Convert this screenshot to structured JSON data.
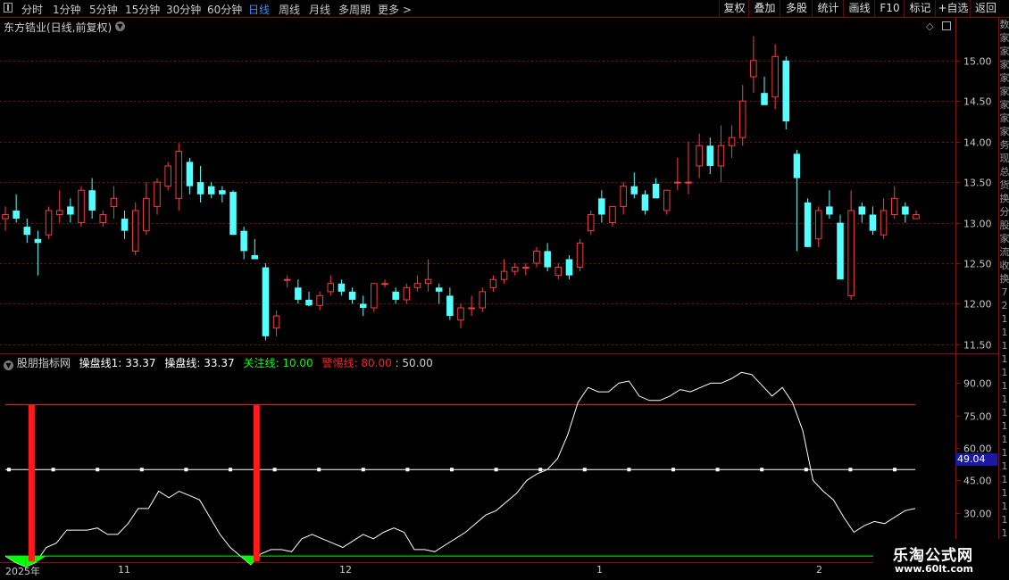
{
  "topbar": {
    "periods": [
      "分时",
      "1分钟",
      "5分钟",
      "15分钟",
      "30分钟",
      "60分钟",
      "日线",
      "周线",
      "月线",
      "多周期",
      "更多 >"
    ],
    "active_period": "日线",
    "right_buttons": [
      "复权",
      "叠加",
      "多股",
      "统计",
      "画线",
      "F10",
      "标记",
      "+自选",
      "返回"
    ]
  },
  "main_chart": {
    "title": "东方锆业(日线,前复权)",
    "title_icon": "chevron-down-icon",
    "price_ticks": [
      "15.00",
      "14.50",
      "14.00",
      "13.50",
      "13.00",
      "12.50",
      "12.00",
      "11.50"
    ],
    "up_color": "#ff3b3b",
    "down_color": "#54ffff"
  },
  "indicator": {
    "name": "股朋指标网",
    "line1_label": "操盘线1:",
    "line1_value": "33.37",
    "line2_label": "操盘线:",
    "line2_value": "33.37",
    "focus_label": "关注线:",
    "focus_value": "10.00",
    "alert_label": "警惕线:",
    "alert_value": "80.00",
    "mid_value": ": 50.00",
    "ticks": [
      "90.00",
      "75.00",
      "60.00",
      "45.00",
      "30.00"
    ],
    "highlight_value": "49.04",
    "focus_color": "#00ff00",
    "alert_color": "#ff2020"
  },
  "date_axis": [
    "2025年",
    "11",
    "12",
    "1",
    "2"
  ],
  "watermark": {
    "title": "乐淘公式网",
    "url": "www.60lt.com"
  },
  "sidebar_chars": [
    "数",
    "家",
    "家",
    "家",
    "家",
    "家",
    "家",
    "家",
    "家",
    "务",
    "现",
    "总",
    "货",
    "换",
    "分",
    "股",
    "家",
    "流",
    "收",
    "换",
    "7",
    "2",
    "1",
    "1",
    "1",
    "1",
    "1",
    "1",
    "1",
    "1",
    "1",
    "1",
    "1",
    "1",
    "1",
    "1",
    "1",
    "1",
    "1",
    "1",
    "1"
  ],
  "chart_data": [
    {
      "type": "candlestick",
      "title": "东方锆业(日线,前复权)",
      "ylim": [
        11.4,
        15.35
      ],
      "y_ticks": [
        11.5,
        12.0,
        12.5,
        13.0,
        13.5,
        14.0,
        14.5,
        15.0
      ],
      "x_labels": [
        "2025年",
        "11",
        "12",
        "1",
        "2"
      ],
      "ohlc": [
        [
          13.05,
          13.2,
          12.9,
          13.1
        ],
        [
          13.15,
          13.35,
          13.0,
          13.05
        ],
        [
          12.95,
          13.05,
          12.75,
          12.85
        ],
        [
          12.8,
          12.9,
          12.35,
          12.75
        ],
        [
          12.85,
          13.2,
          12.8,
          13.15
        ],
        [
          13.1,
          13.4,
          13.0,
          13.15
        ],
        [
          13.2,
          13.3,
          13.0,
          13.1
        ],
        [
          13.0,
          13.45,
          12.95,
          13.4
        ],
        [
          13.4,
          13.55,
          13.05,
          13.15
        ],
        [
          13.0,
          13.15,
          12.95,
          13.1
        ],
        [
          13.2,
          13.45,
          13.05,
          13.3
        ],
        [
          13.05,
          13.15,
          12.8,
          12.9
        ],
        [
          12.65,
          13.25,
          12.6,
          13.15
        ],
        [
          12.9,
          13.5,
          12.85,
          13.3
        ],
        [
          13.2,
          13.55,
          13.1,
          13.5
        ],
        [
          13.45,
          13.75,
          13.4,
          13.7
        ],
        [
          13.3,
          13.98,
          13.15,
          13.88
        ],
        [
          13.75,
          13.8,
          13.35,
          13.45
        ],
        [
          13.5,
          13.7,
          13.25,
          13.35
        ],
        [
          13.45,
          13.5,
          13.3,
          13.35
        ],
        [
          13.4,
          13.45,
          13.25,
          13.35
        ],
        [
          13.38,
          13.4,
          12.85,
          12.85
        ],
        [
          12.9,
          12.95,
          12.55,
          12.65
        ],
        [
          12.6,
          12.8,
          12.55,
          12.55
        ],
        [
          12.45,
          12.5,
          11.55,
          11.6
        ],
        [
          11.7,
          11.92,
          11.6,
          11.85
        ],
        [
          12.3,
          12.35,
          12.2,
          12.3
        ],
        [
          12.2,
          12.3,
          12.0,
          12.05
        ],
        [
          12.05,
          12.15,
          11.97,
          11.98
        ],
        [
          11.98,
          12.15,
          11.92,
          12.1
        ],
        [
          12.15,
          12.35,
          12.1,
          12.25
        ],
        [
          12.25,
          12.3,
          12.1,
          12.15
        ],
        [
          12.15,
          12.2,
          12.0,
          12.05
        ],
        [
          12.0,
          12.1,
          11.85,
          11.95
        ],
        [
          11.95,
          12.25,
          11.9,
          12.25
        ],
        [
          12.25,
          12.3,
          12.2,
          12.25
        ],
        [
          12.15,
          12.2,
          12.0,
          12.05
        ],
        [
          12.05,
          12.25,
          12.0,
          12.2
        ],
        [
          12.2,
          12.35,
          12.15,
          12.25
        ],
        [
          12.25,
          12.55,
          12.15,
          12.3
        ],
        [
          12.2,
          12.25,
          12.0,
          12.15
        ],
        [
          12.1,
          12.2,
          11.8,
          11.85
        ],
        [
          11.8,
          12.0,
          11.7,
          11.95
        ],
        [
          11.95,
          12.1,
          11.85,
          11.95
        ],
        [
          11.95,
          12.2,
          11.9,
          12.15
        ],
        [
          12.2,
          12.35,
          12.15,
          12.3
        ],
        [
          12.3,
          12.55,
          12.25,
          12.4
        ],
        [
          12.4,
          12.5,
          12.35,
          12.45
        ],
        [
          12.45,
          12.5,
          12.35,
          12.45
        ],
        [
          12.5,
          12.7,
          12.45,
          12.65
        ],
        [
          12.65,
          12.75,
          12.4,
          12.45
        ],
        [
          12.35,
          12.5,
          12.3,
          12.45
        ],
        [
          12.55,
          12.6,
          12.3,
          12.35
        ],
        [
          12.45,
          12.8,
          12.4,
          12.75
        ],
        [
          12.9,
          13.15,
          12.85,
          13.1
        ],
        [
          13.3,
          13.4,
          13.0,
          13.1
        ],
        [
          13.0,
          13.2,
          12.95,
          13.2
        ],
        [
          13.2,
          13.5,
          13.1,
          13.45
        ],
        [
          13.45,
          13.62,
          13.3,
          13.35
        ],
        [
          13.35,
          13.4,
          13.1,
          13.15
        ],
        [
          13.48,
          13.55,
          13.3,
          13.3
        ],
        [
          13.15,
          13.35,
          13.1,
          13.4
        ],
        [
          13.5,
          13.8,
          13.4,
          13.5
        ],
        [
          13.5,
          14.0,
          13.35,
          13.5
        ],
        [
          13.7,
          14.1,
          13.55,
          13.95
        ],
        [
          13.95,
          14.05,
          13.6,
          13.7
        ],
        [
          13.7,
          14.2,
          13.5,
          13.95
        ],
        [
          13.95,
          14.2,
          13.8,
          14.05
        ],
        [
          14.05,
          14.7,
          13.95,
          14.5
        ],
        [
          14.8,
          15.3,
          14.6,
          15.0
        ],
        [
          14.6,
          14.8,
          14.45,
          14.45
        ],
        [
          14.55,
          15.2,
          14.4,
          15.05
        ],
        [
          15.0,
          15.05,
          14.15,
          14.25
        ],
        [
          13.85,
          13.9,
          12.65,
          13.55
        ],
        [
          13.25,
          13.3,
          12.7,
          12.7
        ],
        [
          12.8,
          13.2,
          12.7,
          13.15
        ],
        [
          13.2,
          13.4,
          13.05,
          13.1
        ],
        [
          13.0,
          13.1,
          12.45,
          12.3
        ],
        [
          12.1,
          13.4,
          12.05,
          13.15
        ],
        [
          13.2,
          13.25,
          13.0,
          13.1
        ],
        [
          13.1,
          13.2,
          12.85,
          12.9
        ],
        [
          12.85,
          13.3,
          12.8,
          13.15
        ],
        [
          13.1,
          13.45,
          13.05,
          13.3
        ],
        [
          13.2,
          13.25,
          13.0,
          13.1
        ],
        [
          13.05,
          13.15,
          13.05,
          13.1
        ]
      ]
    },
    {
      "type": "line",
      "title": "股朋指标网",
      "ylim": [
        8,
        98
      ],
      "y_ticks": [
        30,
        45,
        60,
        75,
        90
      ],
      "series": [
        {
          "name": "操盘线",
          "values": [
            10,
            7,
            5,
            7,
            14,
            16,
            22,
            22,
            22,
            23,
            20,
            20,
            25,
            32,
            32,
            40,
            37,
            40,
            38,
            36,
            28,
            20,
            14,
            10,
            6,
            11,
            13,
            13,
            12,
            18,
            20,
            18,
            16,
            14,
            17,
            20,
            18,
            21,
            23,
            21,
            13,
            13,
            12,
            15,
            18,
            21,
            25,
            29,
            31,
            35,
            39,
            45,
            48,
            50,
            55,
            66,
            81,
            88,
            86,
            86,
            90,
            91,
            84,
            82,
            82,
            84,
            87,
            86,
            88,
            90,
            90,
            92,
            95,
            94,
            89,
            84,
            88,
            81,
            68,
            45,
            40,
            36,
            28,
            21,
            24,
            26,
            25,
            28,
            31,
            32
          ]
        },
        {
          "name": "关注线",
          "values": [
            10
          ]
        },
        {
          "name": "警惕线",
          "values": [
            80
          ]
        }
      ],
      "signal_bars_at": [
        2,
        24
      ]
    }
  ]
}
